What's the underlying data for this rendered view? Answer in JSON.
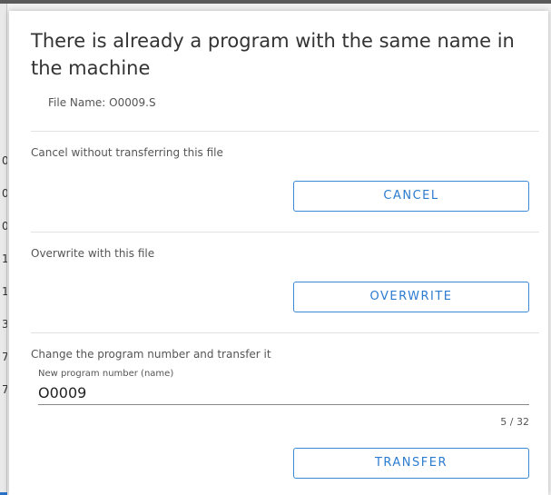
{
  "backdrop": {
    "clipped_digits": [
      "0",
      "0",
      "0",
      "1",
      "1",
      "3",
      "7",
      "7"
    ]
  },
  "dialog": {
    "title": "There is already a program with the same name in the machine",
    "file_name": "File Name: O0009.S",
    "sections": {
      "cancel": {
        "description": "Cancel without transferring this file",
        "button_label": "CANCEL"
      },
      "overwrite": {
        "description": "Overwrite with this file",
        "button_label": "OVERWRITE"
      },
      "transfer": {
        "description": "Change the program number and transfer it",
        "field_label": "New program number (name)",
        "field_value": "O0009",
        "char_count": "5 / 32",
        "button_label": "TRANSFER"
      }
    }
  },
  "colors": {
    "accent": "#2b7bd0",
    "border": "#3a8ad6",
    "divider": "#e2e2e2"
  }
}
